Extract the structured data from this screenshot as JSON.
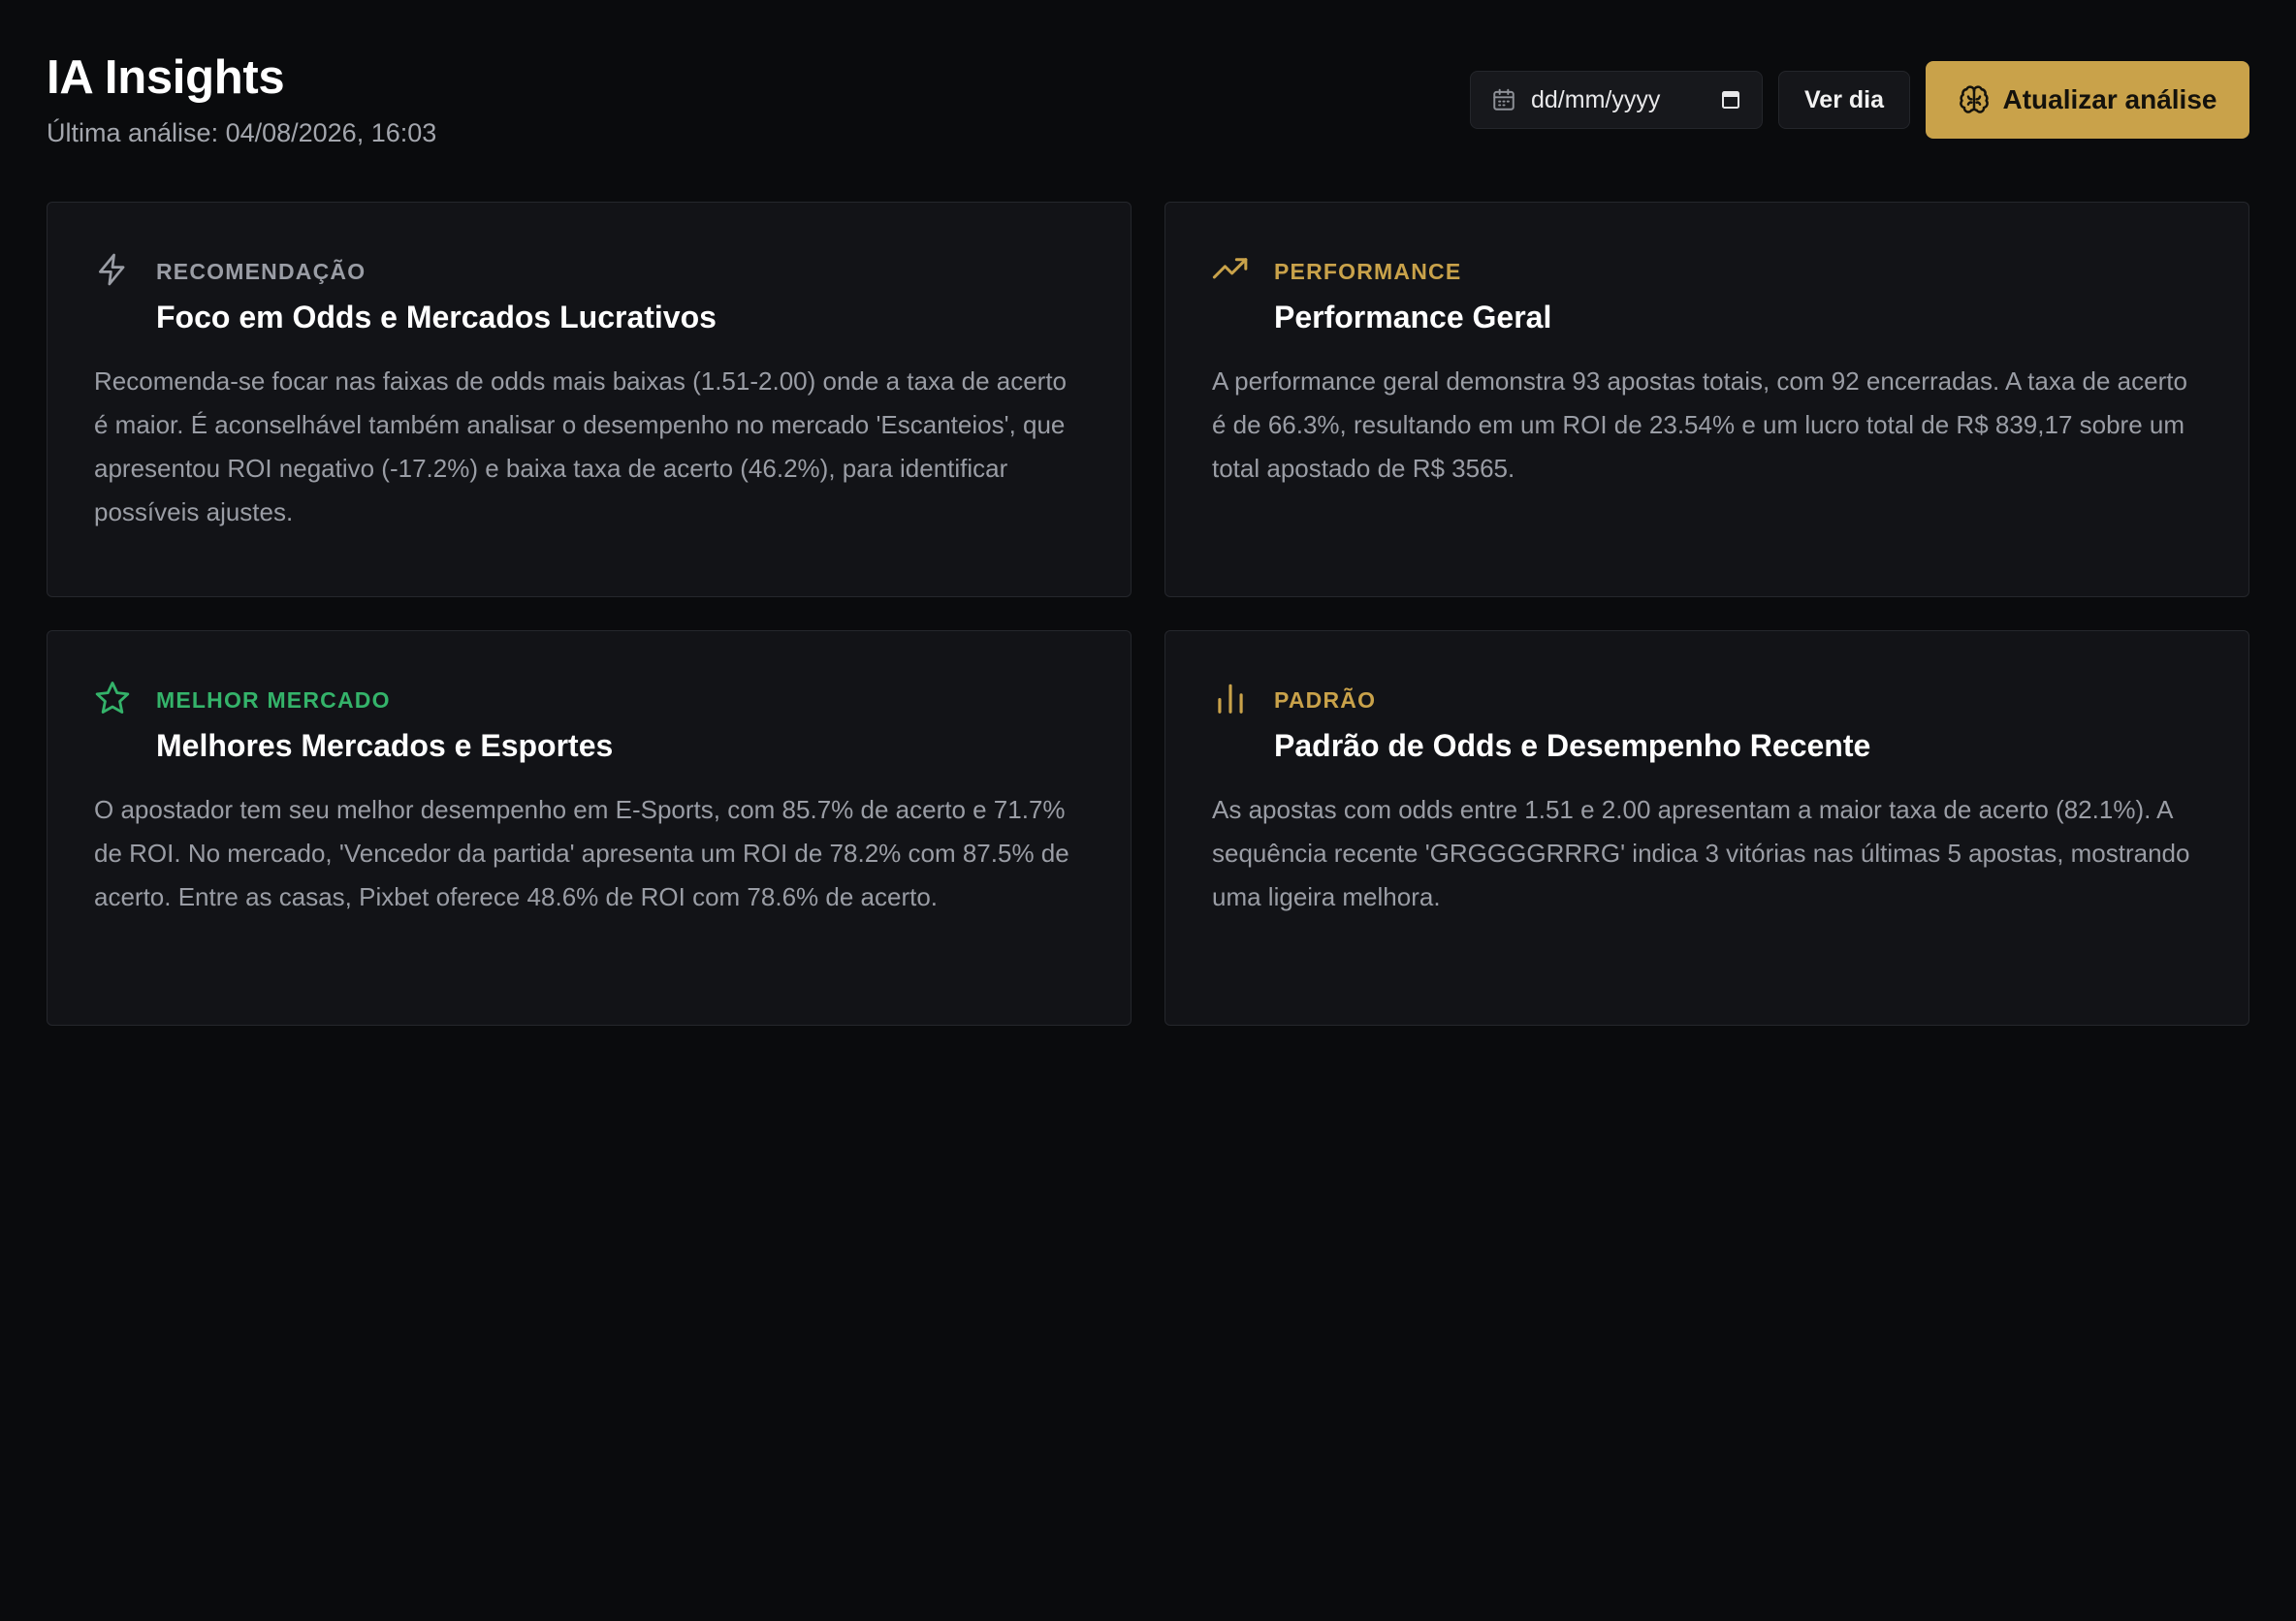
{
  "header": {
    "title": "IA Insights",
    "subtitle": "Última análise: 04/08/2026, 16:03"
  },
  "controls": {
    "date_placeholder": "dd/mm/yyyy",
    "ver_dia_label": "Ver dia",
    "update_label": "Atualizar análise"
  },
  "colors": {
    "background": "#0a0b0d",
    "card": "#121317",
    "accent_gold": "#c9a24a",
    "green": "#34b36a",
    "gray_tag": "#9a9da5"
  },
  "cards": [
    {
      "icon": "zap-icon",
      "tag": "RECOMENDAÇÃO",
      "title": "Foco em Odds e Mercados Lucrativos",
      "body": "Recomenda-se focar nas faixas de odds mais baixas (1.51-2.00) onde a taxa de acerto é maior. É aconselhável também analisar o desempenho no mercado 'Escanteios', que apresentou ROI negativo (-17.2%) e baixa taxa de acerto (46.2%), para identificar possíveis ajustes."
    },
    {
      "icon": "trending-up-icon",
      "tag": "PERFORMANCE",
      "title": "Performance Geral",
      "body": "A performance geral demonstra 93 apostas totais, com 92 encerradas. A taxa de acerto é de 66.3%, resultando em um ROI de 23.54% e um lucro total de R$ 839,17 sobre um total apostado de R$ 3565."
    },
    {
      "icon": "star-icon",
      "tag": "MELHOR MERCADO",
      "title": "Melhores Mercados e Esportes",
      "body": "O apostador tem seu melhor desempenho em E-Sports, com 85.7% de acerto e 71.7% de ROI. No mercado, 'Vencedor da partida' apresenta um ROI de 78.2% com 87.5% de acerto. Entre as casas, Pixbet oferece 48.6% de ROI com 78.6% de acerto."
    },
    {
      "icon": "bar-chart-icon",
      "tag": "PADRÃO",
      "title": "Padrão de Odds e Desempenho Recente",
      "body": "As apostas com odds entre 1.51 e 2.00 apresentam a maior taxa de acerto (82.1%). A sequência recente 'GRGGGGRRRG' indica 3 vitórias nas últimas 5 apostas, mostrando uma ligeira melhora."
    }
  ]
}
